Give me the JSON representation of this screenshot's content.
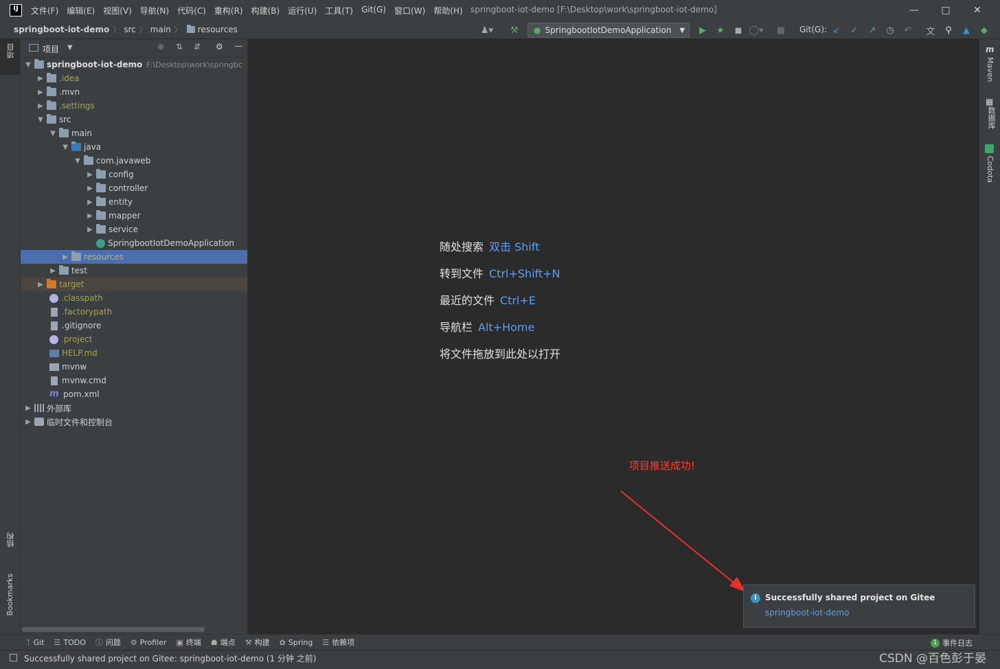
{
  "menubar": {
    "logo": "IJ",
    "items": [
      "文件(F)",
      "编辑(E)",
      "视图(V)",
      "导航(N)",
      "代码(C)",
      "重构(R)",
      "构建(B)",
      "运行(U)",
      "工具(T)",
      "Git(G)",
      "窗口(W)",
      "帮助(H)"
    ],
    "window_title": "springboot-iot-demo [F:\\Desktop\\work\\springboot-iot-demo]"
  },
  "navbar": {
    "breadcrumb": [
      "springboot-iot-demo",
      "src",
      "main",
      "resources"
    ],
    "run_config": "SpringbootIotDemoApplication",
    "git_label": "Git(G):"
  },
  "left_strip": {
    "project_tab": "项目",
    "structure_tab": "结构",
    "bookmarks_tab": "Bookmarks"
  },
  "project_panel": {
    "title": "项目",
    "tree": [
      {
        "label": "springboot-iot-demo",
        "path": "F:\\Desktop\\work\\springbc"
      },
      {
        "label": ".idea"
      },
      {
        "label": ".mvn"
      },
      {
        "label": ".settings"
      },
      {
        "label": "src"
      },
      {
        "label": "main"
      },
      {
        "label": "java"
      },
      {
        "label": "com.javaweb"
      },
      {
        "label": "config"
      },
      {
        "label": "controller"
      },
      {
        "label": "entity"
      },
      {
        "label": "mapper"
      },
      {
        "label": "service"
      },
      {
        "label": "SpringbootIotDemoApplication"
      },
      {
        "label": "resources"
      },
      {
        "label": "test"
      },
      {
        "label": "target"
      },
      {
        "label": ".classpath"
      },
      {
        "label": ".factorypath"
      },
      {
        "label": ".gitignore"
      },
      {
        "label": ".project"
      },
      {
        "label": "HELP.md"
      },
      {
        "label": "mvnw"
      },
      {
        "label": "mvnw.cmd"
      },
      {
        "label": "pom.xml"
      },
      {
        "label": "外部库"
      },
      {
        "label": "临时文件和控制台"
      }
    ]
  },
  "editor": {
    "hints": [
      {
        "text": "随处搜索",
        "key": "双击 Shift"
      },
      {
        "text": "转到文件",
        "key": "Ctrl+Shift+N"
      },
      {
        "text": "最近的文件",
        "key": "Ctrl+E"
      },
      {
        "text": "导航栏",
        "key": "Alt+Home"
      },
      {
        "text": "将文件拖放到此处以打开",
        "key": ""
      }
    ],
    "annotation": "项目推送成功!"
  },
  "notification": {
    "title": "Successfully shared project on Gitee",
    "link": "springboot-iot-demo"
  },
  "right_strip": {
    "maven": "Maven",
    "database": "数据库",
    "codota": "Codota"
  },
  "bottom_tabs": [
    "Git",
    "TODO",
    "问题",
    "Profiler",
    "终端",
    "端点",
    "构建",
    "Spring",
    "依赖项"
  ],
  "event_log": {
    "count": "1",
    "label": "事件日志"
  },
  "status": {
    "text": "Successfully shared project on Gitee: springboot-iot-demo (1 分钟 之前)",
    "watermark": "CSDN @百色彭于晏"
  }
}
